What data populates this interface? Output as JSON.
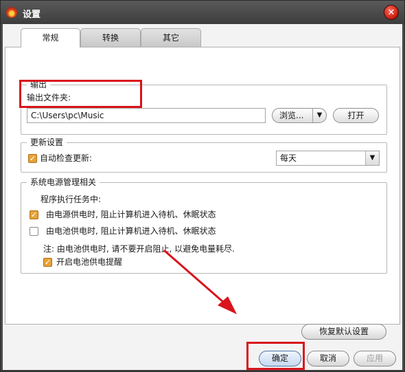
{
  "window": {
    "title": "设置",
    "close_glyph": "✕",
    "tabs": [
      {
        "label": "常规",
        "active": true
      },
      {
        "label": "转换",
        "active": false
      },
      {
        "label": "其它",
        "active": false
      }
    ]
  },
  "output": {
    "group_title": "输出",
    "folder_label": "输出文件夹:",
    "folder_value": "C:\\Users\\pc\\Music",
    "browse_label": "浏览...",
    "browse_arrow": "▼",
    "open_label": "打开"
  },
  "update": {
    "group_title": "更新设置",
    "auto_check_label": "自动检查更新:",
    "auto_check_checked": true,
    "frequency_value": "每天",
    "frequency_arrow": "▼"
  },
  "power": {
    "group_title": "系统电源管理相关",
    "task_label": "程序执行任务中:",
    "ac_label": "由电源供电时, 阻止计算机进入待机、休眠状态",
    "ac_checked": true,
    "battery_label": "由电池供电时, 阻止计算机进入待机、休眠状态",
    "battery_checked": false,
    "note": "注: 由电池供电时, 请不要开启阻止, 以避免电量耗尽.",
    "battery_reminder_label": "开启电池供电提醒",
    "battery_reminder_checked": true
  },
  "footer": {
    "restore_label": "恢复默认设置",
    "ok_label": "确定",
    "cancel_label": "取消",
    "apply_label": "应用"
  },
  "icons": {
    "check_glyph": "✓"
  },
  "colors": {
    "annotation_red": "#d9141b",
    "checkbox_accent": "#e6a33b"
  }
}
